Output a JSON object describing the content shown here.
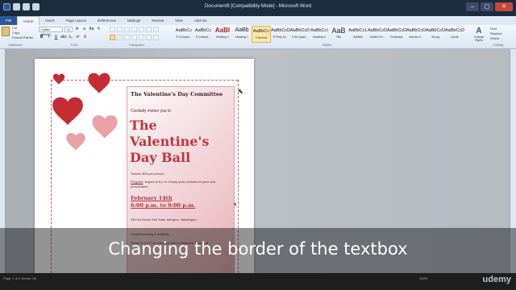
{
  "window": {
    "title": "Document8 [Compatibility Mode] - Microsoft Word",
    "controls": [
      "–",
      "▢",
      "✕"
    ]
  },
  "tabs": [
    "File",
    "Home",
    "Insert",
    "Page Layout",
    "References",
    "Mailings",
    "Review",
    "View",
    "Add-Ins"
  ],
  "ribbon": {
    "clipboard": {
      "paste": "Paste",
      "cut": "Cut",
      "copy": "Copy",
      "format_painter": "Format Painter",
      "label": "Clipboard"
    },
    "font": {
      "name": "Calibri (Body)",
      "size": "11",
      "label": "Font"
    },
    "paragraph": {
      "label": "Paragraph"
    },
    "styles": {
      "label": "Styles",
      "items": [
        {
          "sample": "AaBbCc",
          "name": "¶ Compan..."
        },
        {
          "sample": "AaBbCc",
          "name": "¶ Contact..."
        },
        {
          "sample": "AaBl",
          "name": "Heading 1"
        },
        {
          "sample": "AaBb",
          "name": "Heading 1"
        },
        {
          "sample": "AaBbCc",
          "name": "¶ Normal"
        },
        {
          "sample": "AaBbCcDc",
          "name": "¶ Party Inf..."
        },
        {
          "sample": "AaBbCcDc",
          "name": "¶ No Spaci..."
        },
        {
          "sample": "AaBbCcI",
          "name": "Heading 3"
        },
        {
          "sample": "AaB",
          "name": "Title"
        },
        {
          "sample": "AaBbCcL",
          "name": "Subtitle"
        },
        {
          "sample": "AaBbCcDc",
          "name": "Subtle Em..."
        },
        {
          "sample": "AaBbCcDc",
          "name": "Emphasis"
        },
        {
          "sample": "AaBbCcDc",
          "name": "Intense E..."
        },
        {
          "sample": "AaBbCcDc",
          "name": "Strong"
        },
        {
          "sample": "AaBbCcDc",
          "name": "Quote"
        }
      ],
      "selected_index": 4,
      "change_styles": "Change Styles"
    },
    "editing": {
      "find": "Find",
      "replace": "Replace",
      "select": "Select",
      "label": "Editing"
    }
  },
  "document": {
    "committee": "The Valentine's Day Committee",
    "invite": "Cordially invites you to",
    "title": "The Valentine's Day Ball",
    "tickets": "Tickets: $35 per person",
    "program_label": "Program",
    "program_text": ": begins at 8 p.m. Empty your pockets for your own personalize!",
    "date": "February 14th",
    "time": "6:00 p.m. to 9:00 p.m.",
    "address": "345 3rd Street, Red Suite, Arlington, Washington",
    "parking": "Covered parking is available.",
    "rsvp": "Please R.S.V.P. by February 10th to Stephanie Bourne at"
  },
  "caption": "Changing the border of the textbox",
  "status": {
    "left": "Page: 1 of 1   Words: 66",
    "zoom": "100%"
  },
  "watermark": "udemy"
}
